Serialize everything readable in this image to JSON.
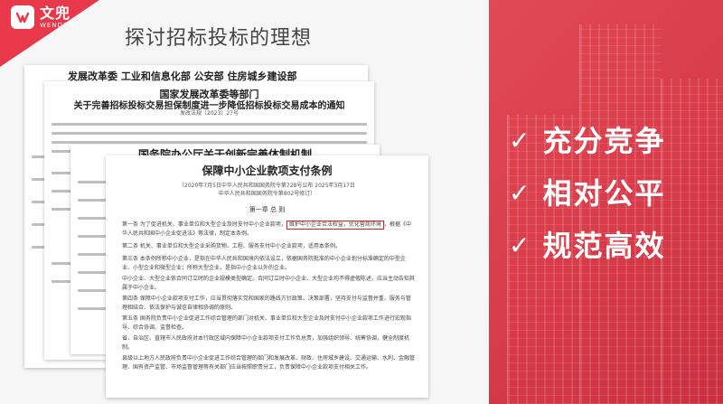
{
  "brand": {
    "name_cn": "文兜",
    "name_en": "WENDOU",
    "color": "#e8384a"
  },
  "page": {
    "title": "探讨招标投标的理想"
  },
  "panel": {
    "color": "#d93c4a",
    "check_symbol": "✓",
    "bullets": [
      {
        "text": "充分竞争"
      },
      {
        "text": "相对公平"
      },
      {
        "text": "规范高效"
      }
    ]
  },
  "documents": {
    "doc1": {
      "header": "发展改革委 工业和信息化部 公安部 住房城乡建设部"
    },
    "doc2": {
      "issuer": "国家发展改革委等部门",
      "title": "关于完善招标投标交易担保制度进一步降低招标投标交易成本的通知",
      "number": "发改法规〔2023〕27号"
    },
    "doc3": {
      "header": "国务院办公厅关于创新完善体制机制"
    },
    "doc4": {
      "title": "保障中小企业款项支付条例",
      "sub1": "（2020年7月5日中华人民共和国国务院令第728号公布  2025年3月17日",
      "sub2": "中华人民共和国国务院令第802号修订）",
      "chapter": "第一章  总  则",
      "p1": "第一条  为了促进机关、事业单位和大型企业及时支付中小企业款项，",
      "highlight": "维护中小企业合法权益，优化营商环境",
      "p1b": "，根据《中华人民共和国中小企业促进法》等法律，制定本条例。",
      "p2": "第二条  机关、事业单位和大型企业采购货物、工程、服务支付中小企业款项，适用本条例。",
      "p3": "第三条  本条例所称中小企业，是指在中华人民共和国境内依法设立，依据国务院批准的中小企业划分标准确定的中型企业、小型企业和微型企业；所称大型企业，是指中小企业以外的企业。",
      "p4": "中小企业、大型企业依合同订立时的企业规模类型确定。合同订立时中小企业、大型企业均不得虚假陈述，应当主动告知其属于中小企业。",
      "p5": "第四条  保障中小企业款项支付工作，应当贯彻落实党和国家的路线方针政策、决策部署，坚持支付与监督并重、服务与管理相结合、依法保护与诚信自律相协调的原则。",
      "p6": "第五条  国务院负责中小企业促进工作综合管理的部门对机关、事业单位和大型企业及时支付中小企业款项工作进行宏观指导、综合协调、监督检查。",
      "p7": "省、自治区、直辖市人民政府对本行政区域内保障中小企业款项支付工作负总责，加强组织领导、统筹协调，健全制度机制。",
      "p8": "县级以上地方人民政府负责中小企业促进工作综合管理的部门和发展改革、财政、住房城乡建设、交通运输、水利、金融管理、国有资产监管、市场监督管理等有关部门应当按照职责分工，负责保障中小企业款项支付相关工作。"
    }
  }
}
